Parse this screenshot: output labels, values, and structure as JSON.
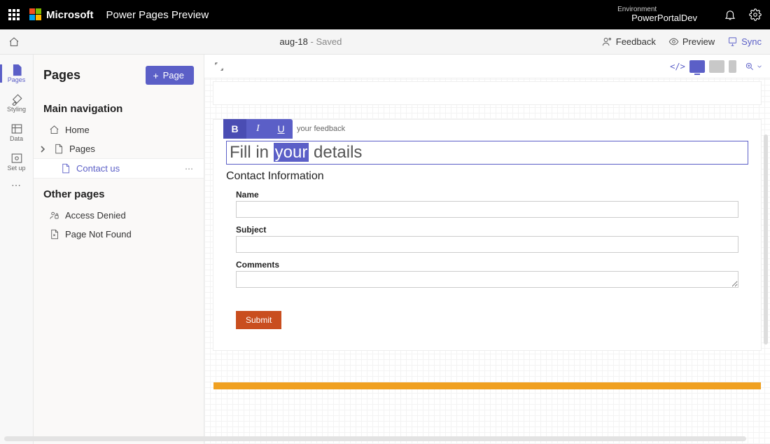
{
  "topbar": {
    "brand": "Microsoft",
    "product": "Power Pages Preview",
    "env_label": "Environment",
    "env_name": "PowerPortalDev"
  },
  "subbar": {
    "page_name": "aug-18",
    "status": "Saved",
    "actions": {
      "feedback": "Feedback",
      "preview": "Preview",
      "sync": "Sync"
    }
  },
  "rail": {
    "pages": "Pages",
    "styling": "Styling",
    "data": "Data",
    "setup": "Set up"
  },
  "sidepanel": {
    "title": "Pages",
    "add_page": "Page",
    "sections": {
      "main_nav": "Main navigation",
      "other_pages": "Other pages"
    },
    "items": {
      "home": "Home",
      "pages": "Pages",
      "contact_us": "Contact us",
      "access_denied": "Access Denied",
      "not_found": "Page Not Found"
    }
  },
  "canvas": {
    "crumb_hint": "your feedback",
    "heading_pre": "Fill in ",
    "heading_sel": "your",
    "heading_post": " details",
    "subheading": "Contact Information",
    "fields": {
      "name": "Name",
      "subject": "Subject",
      "comments": "Comments"
    },
    "submit": "Submit"
  }
}
